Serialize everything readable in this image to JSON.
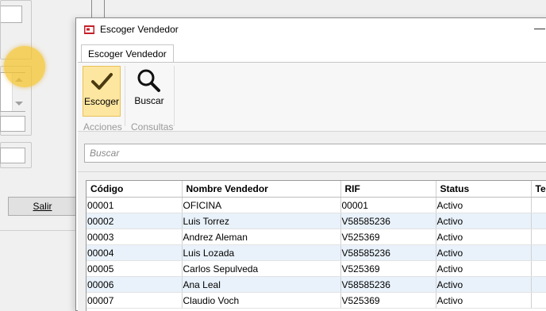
{
  "background_window": {
    "exit_button": "Salir"
  },
  "dialog": {
    "title": "Escoger Vendedor",
    "minimize_glyph": "—",
    "ribbon": {
      "tab": "Escoger Vendedor",
      "buttons": [
        {
          "label": "Escoger",
          "icon": "checkmark-icon"
        },
        {
          "label": "Buscar",
          "icon": "magnifier-icon"
        }
      ],
      "groups": [
        "Acciones",
        "Consultas"
      ]
    },
    "search": {
      "placeholder": "Buscar",
      "value": ""
    },
    "table": {
      "columns": [
        "Código",
        "Nombre Vendedor",
        "RIF",
        "Status",
        "Tel"
      ],
      "rows": [
        [
          "00001",
          "OFICINA",
          "00001",
          "Activo",
          ""
        ],
        [
          "00002",
          "Luis Torrez",
          "V58585236",
          "Activo",
          ""
        ],
        [
          "00003",
          "Andrez Aleman",
          "V525369",
          "Activo",
          ""
        ],
        [
          "00004",
          "Luis Lozada",
          "V58585236",
          "Activo",
          ""
        ],
        [
          "00005",
          "Carlos Sepulveda",
          "V525369",
          "Activo",
          ""
        ],
        [
          "00006",
          "Ana Leal",
          "V58585236",
          "Activo",
          ""
        ],
        [
          "00007",
          "Claudio Voch",
          "V525369",
          "Activo",
          ""
        ]
      ]
    }
  },
  "colors": {
    "selected_button": "#fde6a0",
    "row_alt": "#e9f2fb",
    "highlight": "#f5c328"
  }
}
